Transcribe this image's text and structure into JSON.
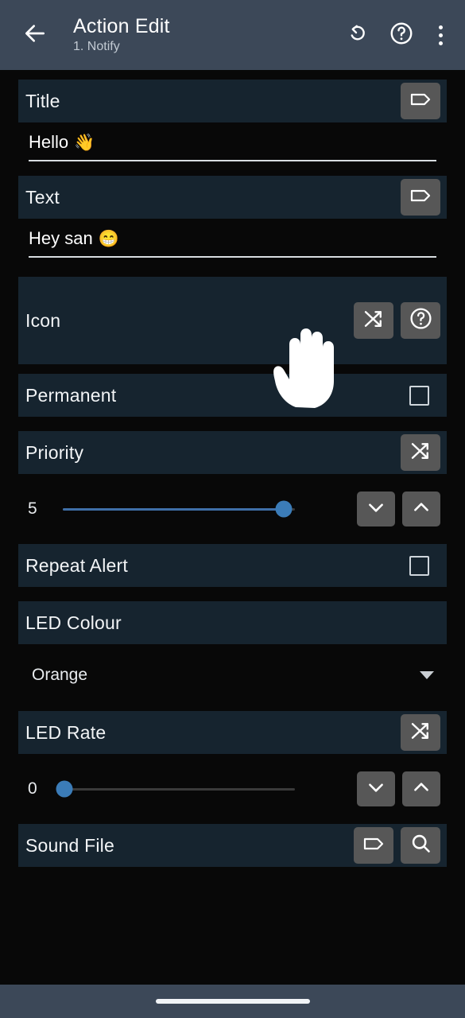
{
  "appbar": {
    "back_icon": "arrow-left-icon",
    "title": "Action Edit",
    "subtitle": "1. Notify",
    "undo_icon": "undo-rotate-left-icon",
    "help_icon": "help-circle-icon",
    "overflow_icon": "more-vertical-icon"
  },
  "colors": {
    "appbar_bg": "#3c4858",
    "row_header_bg": "#16242f",
    "page_bg": "#080808",
    "button_bg": "#575757",
    "slider_accent": "#3b7cb8",
    "text_primary": "#ffffff",
    "text_secondary": "#c2cad3"
  },
  "fields": {
    "title": {
      "label": "Title",
      "tag_icon": "tag-icon",
      "value": "Hello",
      "value_emoji": "👋"
    },
    "text": {
      "label": "Text",
      "tag_icon": "tag-icon",
      "value": "Hey san",
      "value_emoji": "😁"
    },
    "icon": {
      "label": "Icon",
      "shuffle_icon": "shuffle-icon",
      "help_icon": "help-circle-icon"
    },
    "permanent": {
      "label": "Permanent",
      "checkbox_icon": "checkbox-unchecked-icon",
      "checked": false
    },
    "priority": {
      "label": "Priority",
      "shuffle_icon": "shuffle-icon",
      "value": "5",
      "min": 0,
      "max": 5,
      "percent": 100,
      "decrement_icon": "chevron-down-icon",
      "increment_icon": "chevron-up-icon"
    },
    "repeat_alert": {
      "label": "Repeat Alert",
      "checkbox_icon": "checkbox-unchecked-icon",
      "checked": false
    },
    "led_colour": {
      "label": "LED Colour",
      "value": "Orange",
      "caret_icon": "chevron-down-icon"
    },
    "led_rate": {
      "label": "LED Rate",
      "shuffle_icon": "shuffle-icon",
      "value": "0",
      "min": 0,
      "max": 100,
      "percent": 0,
      "decrement_icon": "chevron-down-icon",
      "increment_icon": "chevron-up-icon"
    },
    "sound_file": {
      "label": "Sound File",
      "tag_icon": "tag-icon",
      "search_icon": "search-icon"
    }
  },
  "cursor": {
    "icon": "hand-cursor-icon"
  },
  "navbar": {
    "pill": "gesture-home-pill"
  }
}
